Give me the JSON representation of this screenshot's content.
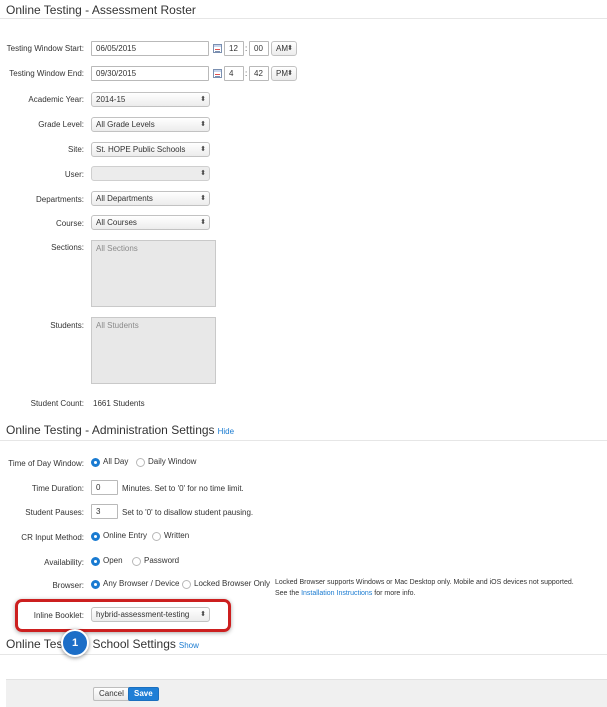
{
  "roster": {
    "title": "Online Testing - Assessment Roster",
    "window_start": {
      "label": "Testing Window Start:",
      "date": "06/05/2015",
      "hour": "12",
      "minute": "00",
      "ampm": "AM"
    },
    "window_end": {
      "label": "Testing Window End:",
      "date": "09/30/2015",
      "hour": "4",
      "minute": "42",
      "ampm": "PM"
    },
    "time_separator": ":",
    "academic_year": {
      "label": "Academic Year:",
      "value": "2014-15"
    },
    "grade_level": {
      "label": "Grade Level:",
      "value": "All Grade Levels"
    },
    "site": {
      "label": "Site:",
      "value": "St. HOPE Public Schools"
    },
    "user": {
      "label": "User:",
      "value": ""
    },
    "departments": {
      "label": "Departments:",
      "value": "All Departments"
    },
    "course": {
      "label": "Course:",
      "value": "All Courses"
    },
    "sections": {
      "label": "Sections:",
      "value": "All Sections"
    },
    "students": {
      "label": "Students:",
      "value": "All Students"
    },
    "student_count": {
      "label": "Student Count:",
      "value": "1661 Students"
    }
  },
  "admin": {
    "title": "Online Testing - Administration Settings",
    "toggle": "Hide",
    "time_of_day": {
      "label": "Time of Day Window:",
      "options": [
        "All Day",
        "Daily Window"
      ],
      "selected": 0
    },
    "time_duration": {
      "label": "Time Duration:",
      "value": "0",
      "hint": "Minutes.  Set to '0' for no time limit."
    },
    "student_pauses": {
      "label": "Student Pauses:",
      "value": "3",
      "hint": "Set to '0' to disallow student pausing."
    },
    "cr_input": {
      "label": "CR Input Method:",
      "options": [
        "Online Entry",
        "Written"
      ],
      "selected": 0
    },
    "availability": {
      "label": "Availability:",
      "options": [
        "Open",
        "Password"
      ],
      "selected": 0
    },
    "browser": {
      "label": "Browser:",
      "options": [
        "Any Browser / Device",
        "Locked Browser Only"
      ],
      "selected": 0,
      "note_line1": "Locked Browser supports Windows or Mac Desktop only. Mobile and iOS devices not supported.",
      "note_pre": "See the",
      "note_link": "Installation Instructions",
      "note_post": "for more info."
    },
    "inline_booklet": {
      "label": "Inline Booklet:",
      "value": "hybrid-assessment-testing"
    }
  },
  "school": {
    "title": "Online Testing - School Settings",
    "toggle": "Show"
  },
  "callout": {
    "number": "1"
  },
  "footer": {
    "cancel": "Cancel",
    "save": "Save"
  },
  "colors": {
    "accent": "#1a7bd1",
    "highlight": "#cc1f1f",
    "badge": "#1c6ec7"
  }
}
